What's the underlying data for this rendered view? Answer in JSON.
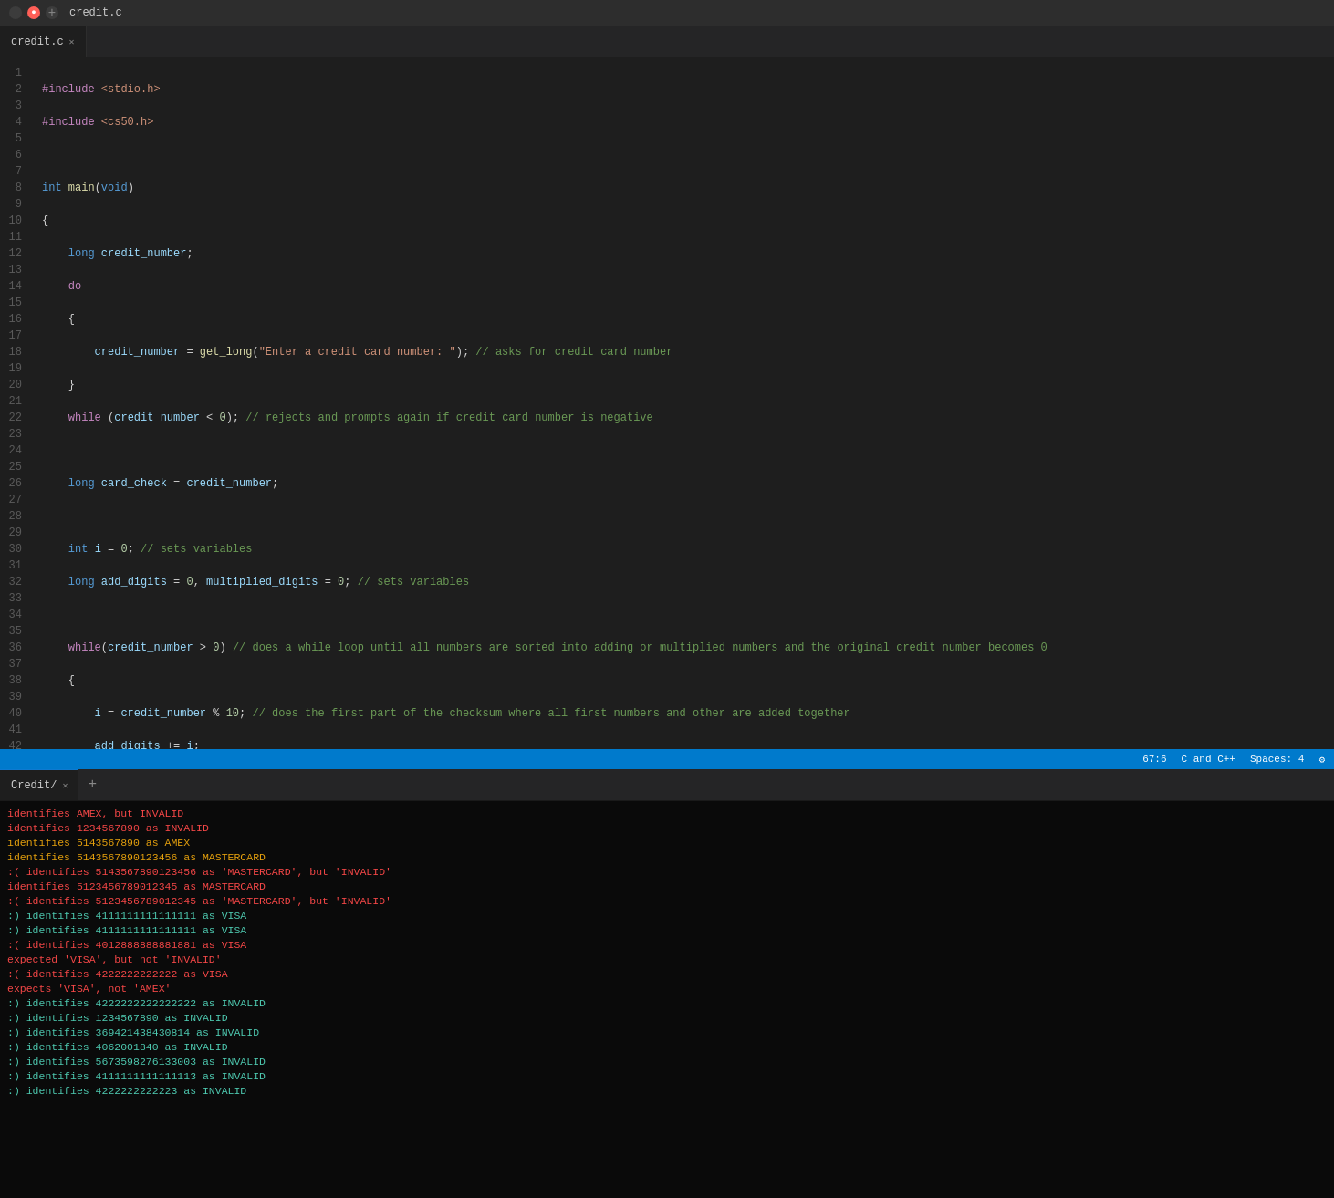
{
  "titleBar": {
    "filename": "credit.c"
  },
  "tabs": [
    {
      "label": "credit.c",
      "active": true
    }
  ],
  "statusBar": {
    "position": "67:6",
    "language": "C and C++",
    "spaces": "Spaces: 4"
  },
  "bottomTabs": [
    {
      "label": "Credit/",
      "active": true
    }
  ],
  "terminalLines": [
    {
      "type": "error",
      "text": "identifies AMEX, but INVALID"
    },
    {
      "type": "error",
      "text": "identifies 1234567890 as INVALID"
    },
    {
      "type": "warn",
      "text": "identifies 5143567890 as AMEX"
    },
    {
      "type": "warn",
      "text": "identifies 5143567890123456 as MASTERCARD"
    },
    {
      "type": "error",
      "text": "identifies 5143567890123456 as 'MASTERCARD', but 'INVALID'"
    },
    {
      "type": "error",
      "text": "identifies 5123456789012345 as MASTERCARD"
    },
    {
      "type": "error",
      "text": "identifies 5123456789012345 as 'MASTERCARD', but 'INVALID'"
    },
    {
      "type": "success",
      "text": ":) identifies 4111111111111111 as VISA"
    },
    {
      "type": "success",
      "text": ":) identifies 4111111111111111 as VISA"
    },
    {
      "type": "error",
      "text": ":( identifies 4012888888881881 as VISA"
    },
    {
      "type": "error",
      "text": "   expected 'VISA', but not 'INVALID'"
    },
    {
      "type": "error",
      "text": ":( identifies 4222222222222 as VISA"
    },
    {
      "type": "error",
      "text": "   expects 'VISA', not 'AMEX'"
    },
    {
      "type": "success",
      "text": ":) identifies 4222222222222222 as INVALID"
    },
    {
      "type": "success",
      "text": ":) identifies 1234567890 as INVALID"
    },
    {
      "type": "success",
      "text": ":) identifies 369421438430814 as INVALID"
    },
    {
      "type": "success",
      "text": ":) identifies 4062001840 as INVALID"
    },
    {
      "type": "success",
      "text": ":) identifies 5673598276133003 as INVALID"
    },
    {
      "type": "success",
      "text": ":) identifies 4111111111111113 as INVALID"
    },
    {
      "type": "success",
      "text": ":) identifies 4222222222223 as INVALID"
    }
  ]
}
